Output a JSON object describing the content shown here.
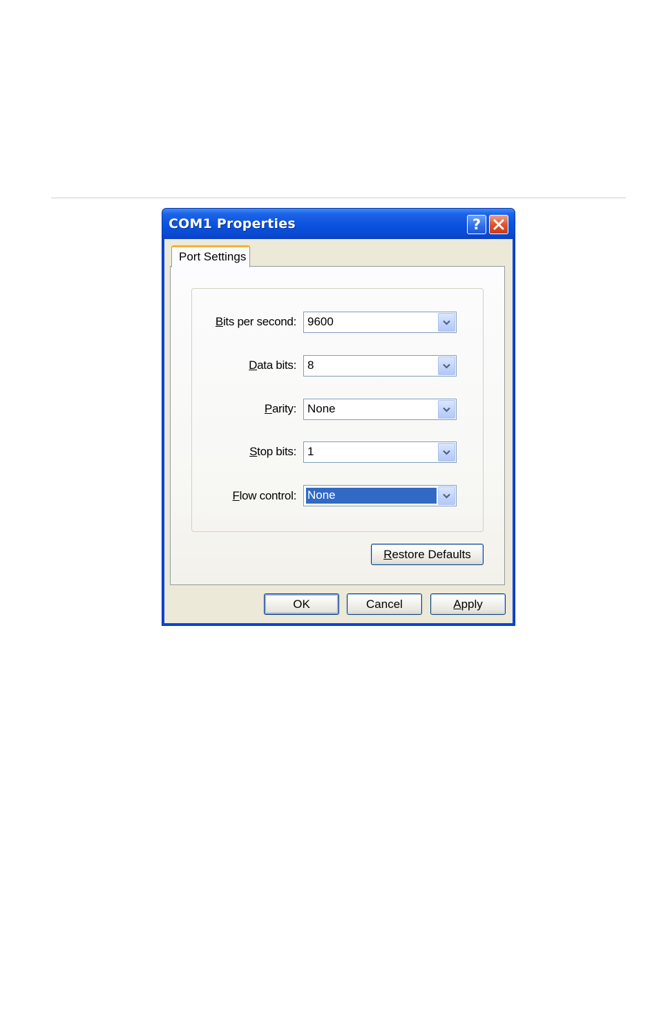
{
  "window": {
    "title": "COM1 Properties",
    "help_glyph": "?"
  },
  "tabs": [
    {
      "label": "Port Settings",
      "active": true
    }
  ],
  "fields": [
    {
      "label_hotkey": "B",
      "label_rest": "its per second:",
      "value": "9600"
    },
    {
      "label_hotkey": "D",
      "label_rest": "ata bits:",
      "value": "8"
    },
    {
      "label_hotkey": "P",
      "label_rest": "arity:",
      "value": "None"
    },
    {
      "label_hotkey": "S",
      "label_rest": "top bits:",
      "value": "1"
    },
    {
      "label_hotkey": "F",
      "label_rest": "low control:",
      "value": "None"
    }
  ],
  "buttons": {
    "restore_hotkey": "R",
    "restore_rest": "estore Defaults",
    "ok": "OK",
    "cancel": "Cancel",
    "apply_hotkey": "A",
    "apply_rest": "pply"
  },
  "colors": {
    "title_bar": "#0a52de",
    "selection": "#316ac5",
    "tab_highlight": "#f6b139",
    "close_button": "#e0532e"
  },
  "icons": {
    "help": "question-mark-icon",
    "close": "close-x-icon",
    "dropdown": "chevron-down-icon"
  }
}
